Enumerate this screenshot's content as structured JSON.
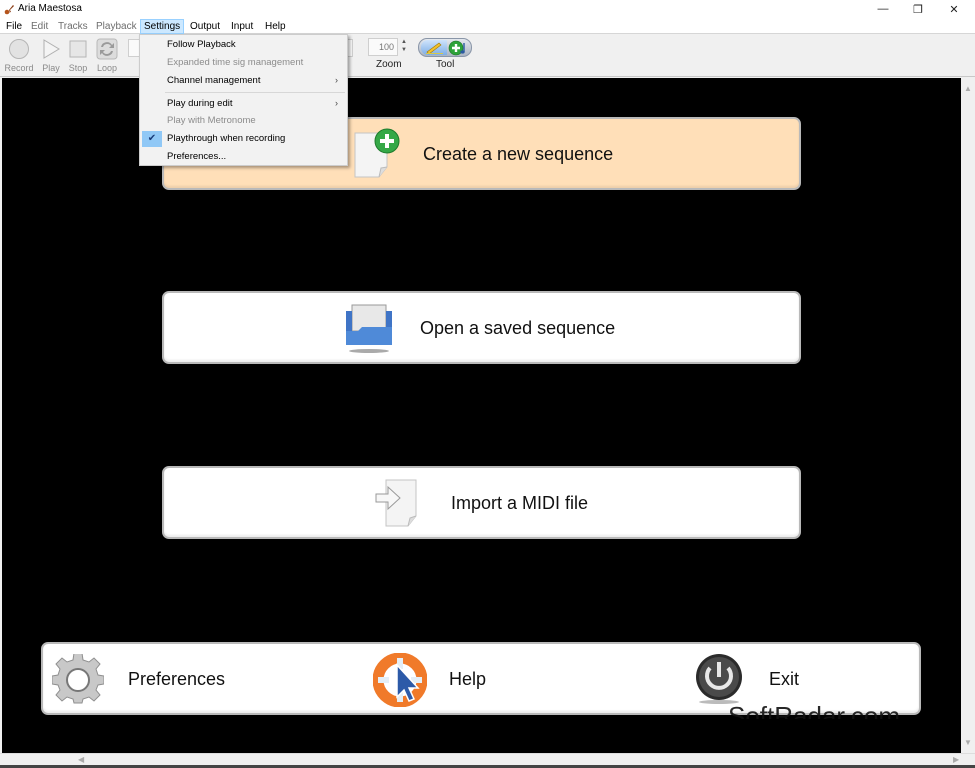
{
  "window": {
    "title": "Aria Maestosa",
    "minimize_glyph": "—",
    "restore_glyph": "❐",
    "close_glyph": "✕"
  },
  "menubar": {
    "items": [
      {
        "label": "File",
        "enabled": true
      },
      {
        "label": "Edit",
        "enabled": false
      },
      {
        "label": "Tracks",
        "enabled": false
      },
      {
        "label": "Playback",
        "enabled": false
      },
      {
        "label": "Settings",
        "enabled": true,
        "active": true
      },
      {
        "label": "Output",
        "enabled": true
      },
      {
        "label": "Input",
        "enabled": true
      },
      {
        "label": "Help",
        "enabled": true
      }
    ]
  },
  "toolbar": {
    "record_label": "Record",
    "play_label": "Play",
    "stop_label": "Stop",
    "loop_label": "Loop",
    "zoom_value": "100",
    "zoom_label": "Zoom",
    "tool_label": "Tool",
    "spin_up": "▲",
    "spin_down": "▼"
  },
  "settings_menu": {
    "items": [
      {
        "label": "Follow Playback",
        "enabled": true
      },
      {
        "label": "Expanded time sig management",
        "enabled": false
      },
      {
        "label": "Channel management",
        "enabled": true,
        "submenu": true
      },
      {
        "label": "Play during edit",
        "enabled": true,
        "submenu": true
      },
      {
        "label": "Play with Metronome",
        "enabled": false
      },
      {
        "label": "Playthrough when recording",
        "enabled": true,
        "checked": true
      },
      {
        "label": "Preferences...",
        "enabled": true
      }
    ],
    "submenu_arrow": "›",
    "check_glyph": "✔"
  },
  "welcome": {
    "create_label": "Create a new sequence",
    "open_label": "Open a saved sequence",
    "import_label": "Import a MIDI file",
    "preferences_label": "Preferences",
    "help_label": "Help",
    "exit_label": "Exit"
  },
  "watermark": "SoftRadar.com",
  "colors": {
    "highlight_button": "#ffdfb8",
    "canvas": "#000000",
    "menu_active": "#cce8ff",
    "check_bg": "#90c8f6"
  }
}
